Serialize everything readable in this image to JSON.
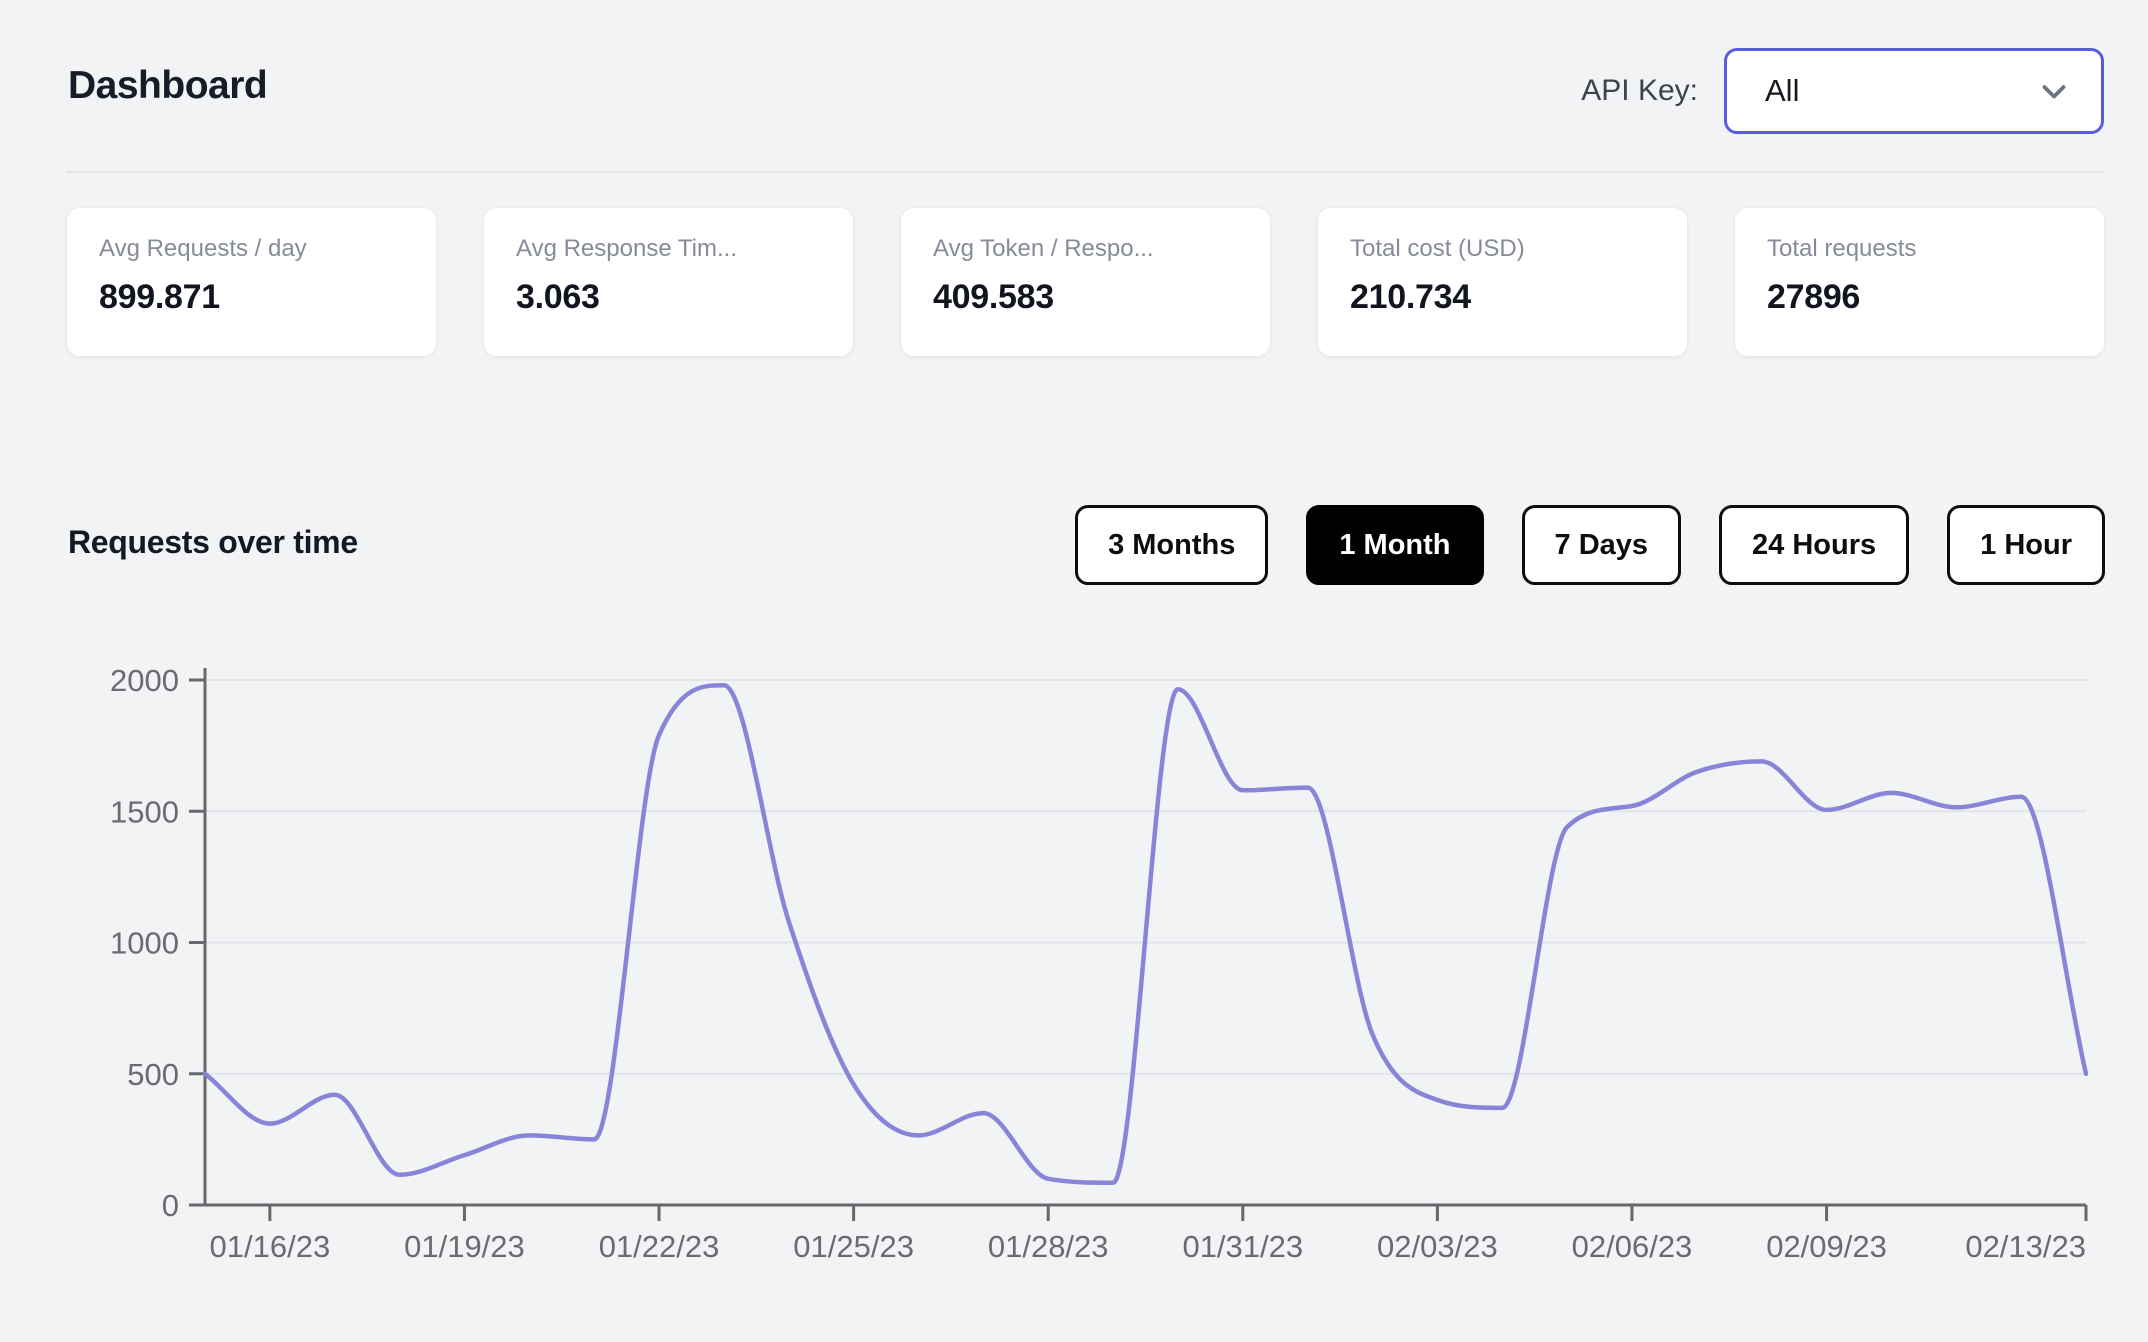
{
  "page": {
    "title": "Dashboard"
  },
  "api_key": {
    "label": "API Key:",
    "selected": "All",
    "chevron_icon": "chevron-down"
  },
  "stats": [
    {
      "label": "Avg Requests / day",
      "value": "899.871"
    },
    {
      "label": "Avg Response Tim...",
      "value": "3.063"
    },
    {
      "label": "Avg Token / Respo...",
      "value": "409.583"
    },
    {
      "label": "Total cost (USD)",
      "value": "210.734"
    },
    {
      "label": "Total requests",
      "value": "27896"
    }
  ],
  "section": {
    "title": "Requests over time"
  },
  "range_buttons": [
    {
      "label": "3 Months",
      "active": false
    },
    {
      "label": "1 Month",
      "active": true
    },
    {
      "label": "7 Days",
      "active": false
    },
    {
      "label": "24 Hours",
      "active": false
    },
    {
      "label": "1 Hour",
      "active": false
    }
  ],
  "colors": {
    "line": "#8884d8",
    "accent": "#5a5ce0",
    "active_button_bg": "#000000",
    "page_bg": "#f2f3f5"
  },
  "chart_data": {
    "type": "line",
    "title": "Requests over time",
    "x": [
      "01/15/23",
      "01/16/23",
      "01/17/23",
      "01/18/23",
      "01/19/23",
      "01/20/23",
      "01/21/23",
      "01/22/23",
      "01/23/23",
      "01/24/23",
      "01/25/23",
      "01/26/23",
      "01/27/23",
      "01/28/23",
      "01/29/23",
      "01/30/23",
      "01/31/23",
      "02/01/23",
      "02/02/23",
      "02/03/23",
      "02/04/23",
      "02/05/23",
      "02/06/23",
      "02/07/23",
      "02/08/23",
      "02/09/23",
      "02/10/23",
      "02/11/23",
      "02/12/23",
      "02/13/23"
    ],
    "values": [
      500,
      310,
      420,
      115,
      190,
      265,
      250,
      1790,
      1980,
      1080,
      460,
      265,
      350,
      100,
      85,
      1965,
      1580,
      1590,
      650,
      400,
      370,
      1440,
      1520,
      1650,
      1690,
      1505,
      1570,
      1515,
      1555,
      500
    ],
    "x_tick_indices": [
      1,
      4,
      7,
      10,
      13,
      16,
      19,
      22,
      25,
      29
    ],
    "x_tick_labels": [
      "01/16/23",
      "01/19/23",
      "01/22/23",
      "01/25/23",
      "01/28/23",
      "01/31/23",
      "02/03/23",
      "02/06/23",
      "02/09/23",
      "02/13/23"
    ],
    "y_ticks": [
      0,
      500,
      1000,
      1500,
      2000
    ],
    "ylim": [
      0,
      2000
    ],
    "xlabel": "",
    "ylabel": "",
    "grid": "horizontal",
    "legend": "none",
    "interpolation": "monotone"
  }
}
